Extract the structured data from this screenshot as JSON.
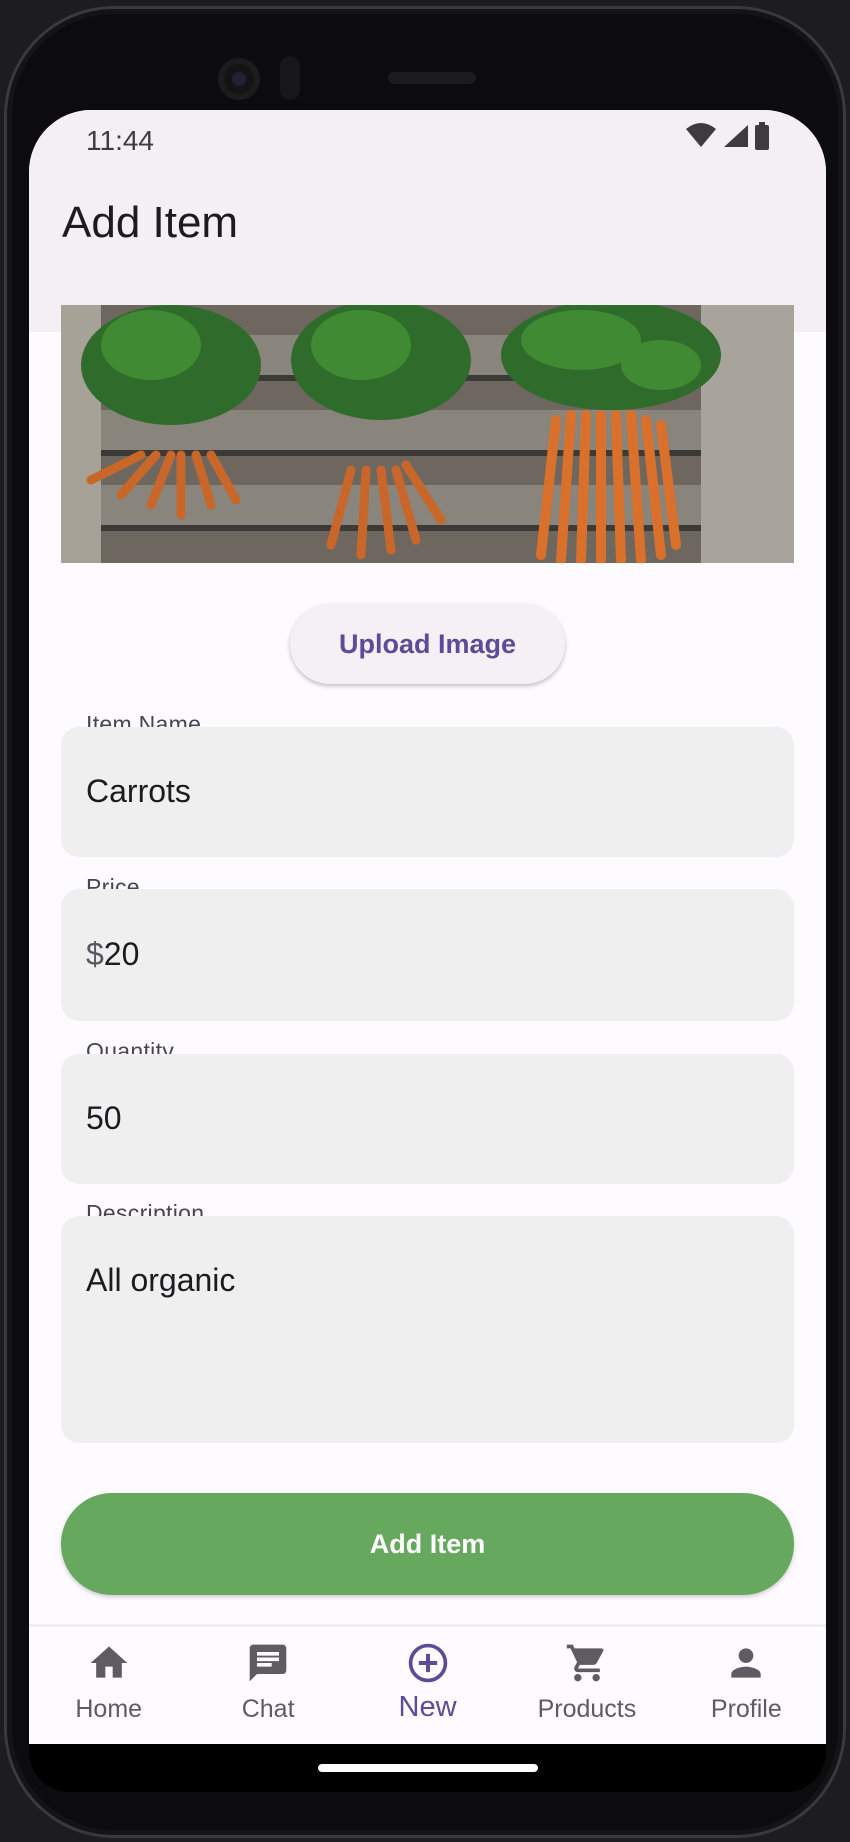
{
  "status_bar": {
    "time": "11:44"
  },
  "app_bar": {
    "title": "Add Item"
  },
  "upload_button": {
    "label": "Upload Image"
  },
  "fields": {
    "item_name": {
      "label": "Item Name",
      "value": "Carrots"
    },
    "price": {
      "label": "Price",
      "prefix": "$",
      "value": "20"
    },
    "quantity": {
      "label": "Quantity",
      "value": "50"
    },
    "description": {
      "label": "Description",
      "value": "All organic"
    }
  },
  "submit_button": {
    "label": "Add Item"
  },
  "bottom_nav": {
    "items": [
      {
        "label": "Home",
        "icon": "home-icon"
      },
      {
        "label": "Chat",
        "icon": "chat-icon"
      },
      {
        "label": "New",
        "icon": "add-circle-icon",
        "active": true
      },
      {
        "label": "Products",
        "icon": "cart-icon"
      },
      {
        "label": "Profile",
        "icon": "person-icon"
      }
    ]
  },
  "colors": {
    "accent": "#5d4a99",
    "primary_button": "#66a85e",
    "appbar": "#f3eff5",
    "field_bg": "#efefef"
  }
}
